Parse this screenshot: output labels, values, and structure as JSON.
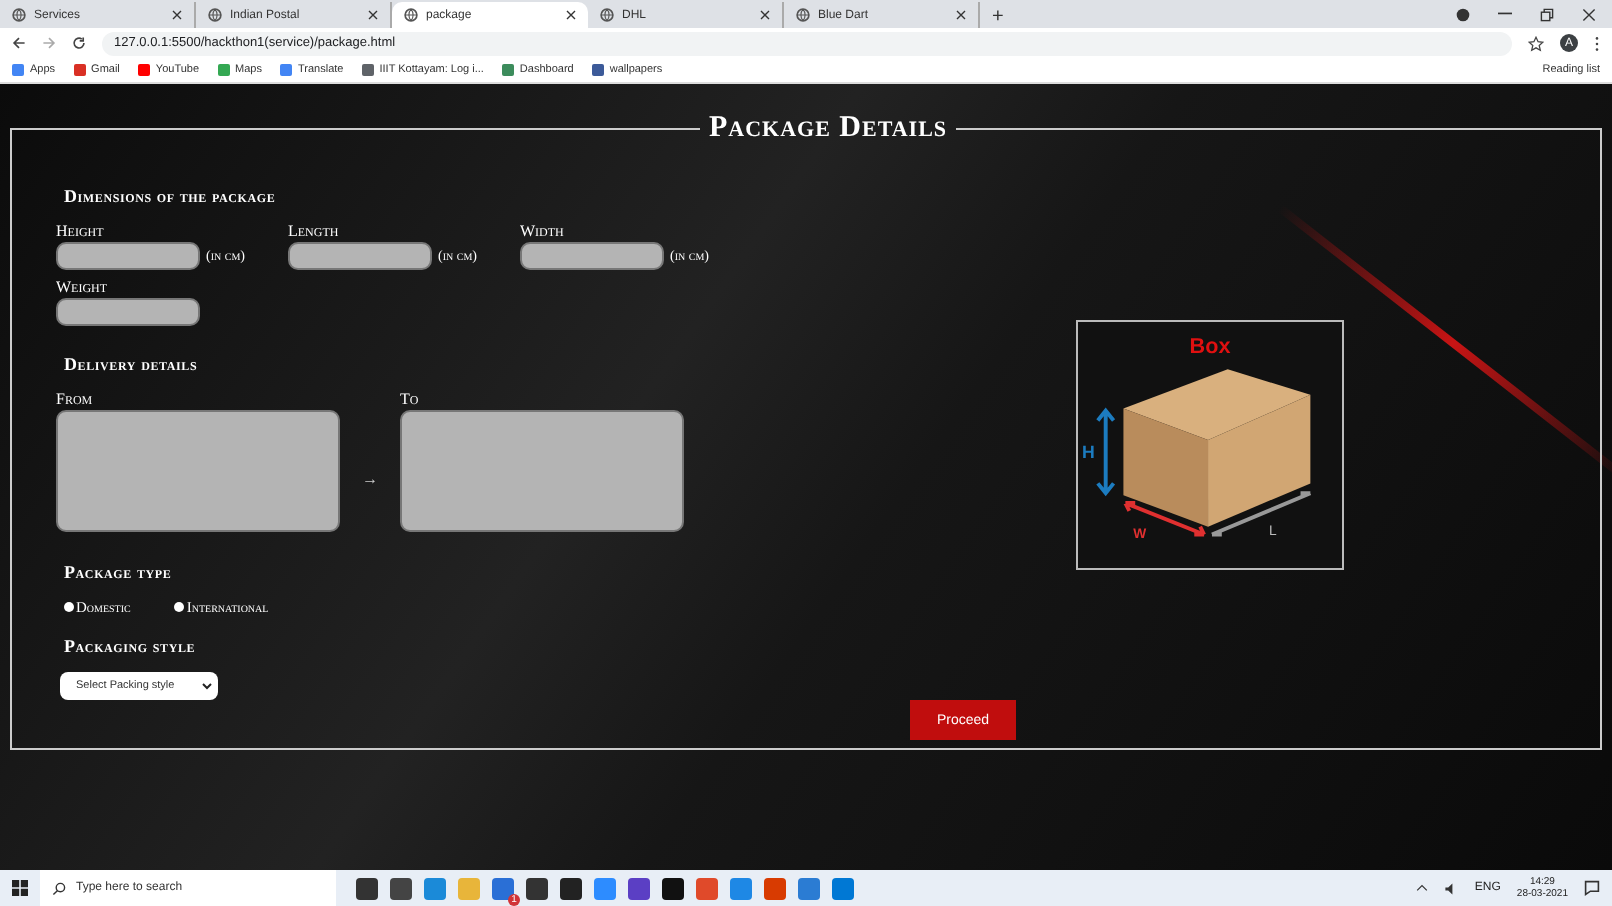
{
  "browser": {
    "tabs": [
      {
        "title": "Services",
        "selected": false
      },
      {
        "title": "Indian Postal",
        "selected": false
      },
      {
        "title": "package",
        "selected": true
      },
      {
        "title": "DHL",
        "selected": false
      },
      {
        "title": "Blue Dart",
        "selected": false
      }
    ],
    "new_tab": "+",
    "address": "127.0.0.1:5500/hackthon1(service)/package.html",
    "profile_initial": "A",
    "bookmarks": [
      {
        "label": "Apps",
        "color": "#4285f4"
      },
      {
        "label": "Gmail",
        "color": "#d93025"
      },
      {
        "label": "YouTube",
        "color": "#ff0000"
      },
      {
        "label": "Maps",
        "color": "#34a853"
      },
      {
        "label": "Translate",
        "color": "#4285f4"
      },
      {
        "label": "IIIT Kottayam: Log i...",
        "color": "#5f6368"
      },
      {
        "label": "Dashboard",
        "color": "#3c8c5c"
      },
      {
        "label": "wallpapers",
        "color": "#3c5a99"
      }
    ],
    "reading_list": "Reading list"
  },
  "page": {
    "title": "Package Details",
    "dimensions": {
      "heading": "Dimensions of the package",
      "fields": [
        {
          "label": "Height",
          "unit": "(in cm)"
        },
        {
          "label": "Length",
          "unit": "(in cm)"
        },
        {
          "label": "Width",
          "unit": "(in cm)"
        },
        {
          "label": "Weight"
        }
      ]
    },
    "delivery": {
      "heading": "Delivery details",
      "from_label": "From",
      "arrow": "→",
      "to_label": "To"
    },
    "package_type": {
      "heading": "Package type",
      "options": [
        {
          "label": "Domestic",
          "selected": false
        },
        {
          "label": "International",
          "selected": false
        }
      ]
    },
    "packaging_style": {
      "heading": "Packaging style",
      "placeholder": "Select Packing style"
    },
    "diagram": {
      "title": "Box",
      "height_label": "H",
      "width_label": "W",
      "length_label": "L"
    },
    "proceed": "Proceed"
  },
  "taskbar": {
    "search_placeholder": "Type here to search",
    "badge": "1",
    "language": "ENG",
    "time": "14:29",
    "date": "28-03-2021"
  }
}
